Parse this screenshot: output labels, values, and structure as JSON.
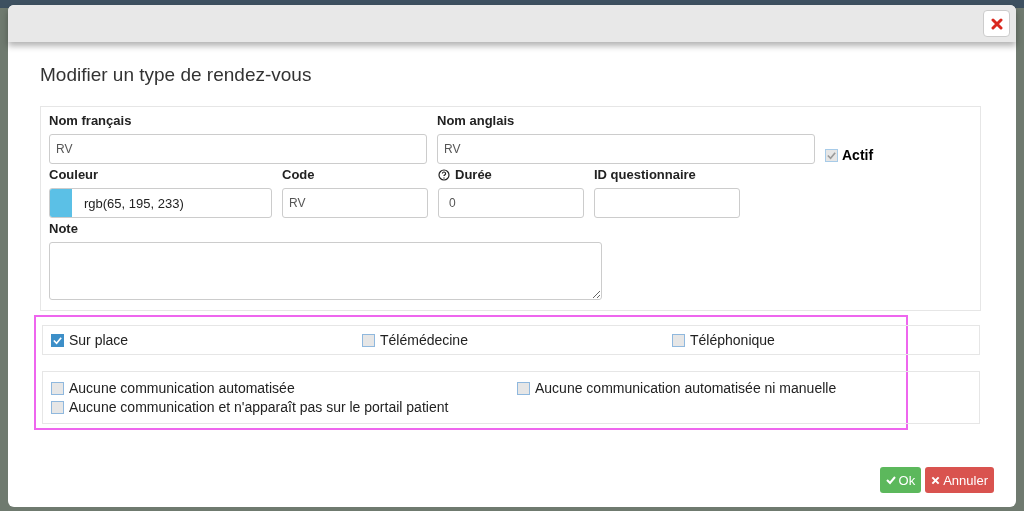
{
  "dialog": {
    "title": "Modifier un type de rendez-vous"
  },
  "fields": {
    "nom_francais": {
      "label": "Nom français",
      "value": "RV"
    },
    "nom_anglais": {
      "label": "Nom anglais",
      "value": "RV"
    },
    "actif": {
      "label": "Actif",
      "checked": true,
      "disabled": true
    },
    "couleur": {
      "label": "Couleur",
      "value": "rgb(65, 195, 233)",
      "color": "#5bc0e6"
    },
    "code": {
      "label": "Code",
      "value": "RV"
    },
    "duree": {
      "label": "Durée",
      "value": "0"
    },
    "id_questionnaire": {
      "label": "ID questionnaire"
    },
    "note": {
      "label": "Note"
    }
  },
  "mode_options": [
    {
      "label": "Sur place",
      "checked": true
    },
    {
      "label": "Télémédecine",
      "checked": false
    },
    {
      "label": "Téléphonique",
      "checked": false
    }
  ],
  "communication_options": [
    {
      "label": "Aucune communication automatisée",
      "checked": false
    },
    {
      "label": "Aucune communication automatisée ni manuelle",
      "checked": false
    },
    {
      "label": "Aucune communication et n'apparaît pas sur le portail patient",
      "checked": false
    }
  ],
  "buttons": [
    {
      "label": "Ok",
      "kind": "ok"
    },
    {
      "label": "Annuler",
      "kind": "cancel"
    }
  ]
}
